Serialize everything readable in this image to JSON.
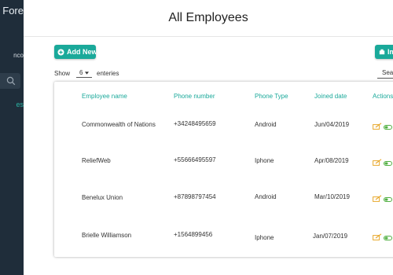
{
  "sidebar": {
    "brand": "Fore",
    "user": "nco",
    "active_item": "es"
  },
  "header": {
    "title": "All Employees"
  },
  "toolbar": {
    "add_label": "Add New",
    "import_label": "Im"
  },
  "table_controls": {
    "show_label": "Show",
    "page_size": "6",
    "entries_label": "enteries",
    "search_label": "Sear"
  },
  "table": {
    "columns": [
      "Employee name",
      "Phone number",
      "Phone Type",
      "Joined date",
      "Actions"
    ],
    "rows": [
      {
        "name": "Commonwealth of Nations",
        "phone": "+34248495659",
        "type": "Android",
        "joined": "Jun/04/2019"
      },
      {
        "name": "ReliefWeb",
        "phone": "+55666495597",
        "type": "Iphone",
        "joined": "Apr/08/2019"
      },
      {
        "name": "Benelux Union",
        "phone": "+87898797454",
        "type": "Android",
        "joined": "Mar/10/2019"
      },
      {
        "name": "Brielle Williamson",
        "phone": "+1564899456",
        "type": "Iphone",
        "joined": "Jan/07/2019"
      }
    ]
  },
  "colors": {
    "accent": "#1aa99a",
    "sidebar_bg": "#1f2d3a",
    "edit_icon": "#e8a92e",
    "toggle_on": "#52b043"
  }
}
